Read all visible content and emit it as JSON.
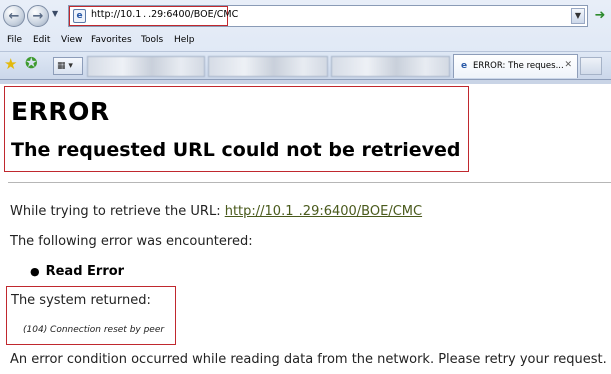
{
  "browser": {
    "address": "http://10.1 . .29:6400/BOE/CMC",
    "menu": [
      "File",
      "Edit",
      "View",
      "Favorites",
      "Tools",
      "Help"
    ],
    "active_tab_title": "ERROR: The reques...",
    "tab_close": "✕"
  },
  "page": {
    "heading": "ERROR",
    "subheading": "The requested URL could not be retrieved",
    "url_prefix": "While trying to retrieve the URL: ",
    "url_link": "http://10.1  .29:6400/BOE/CMC",
    "encountered": "The following error was encountered:",
    "error_item": "Read Error",
    "system_returned": "The system returned:",
    "system_detail": "(104) Connection reset by peer",
    "final_message": "An error condition occurred while reading data from the network. Please retry your request."
  }
}
